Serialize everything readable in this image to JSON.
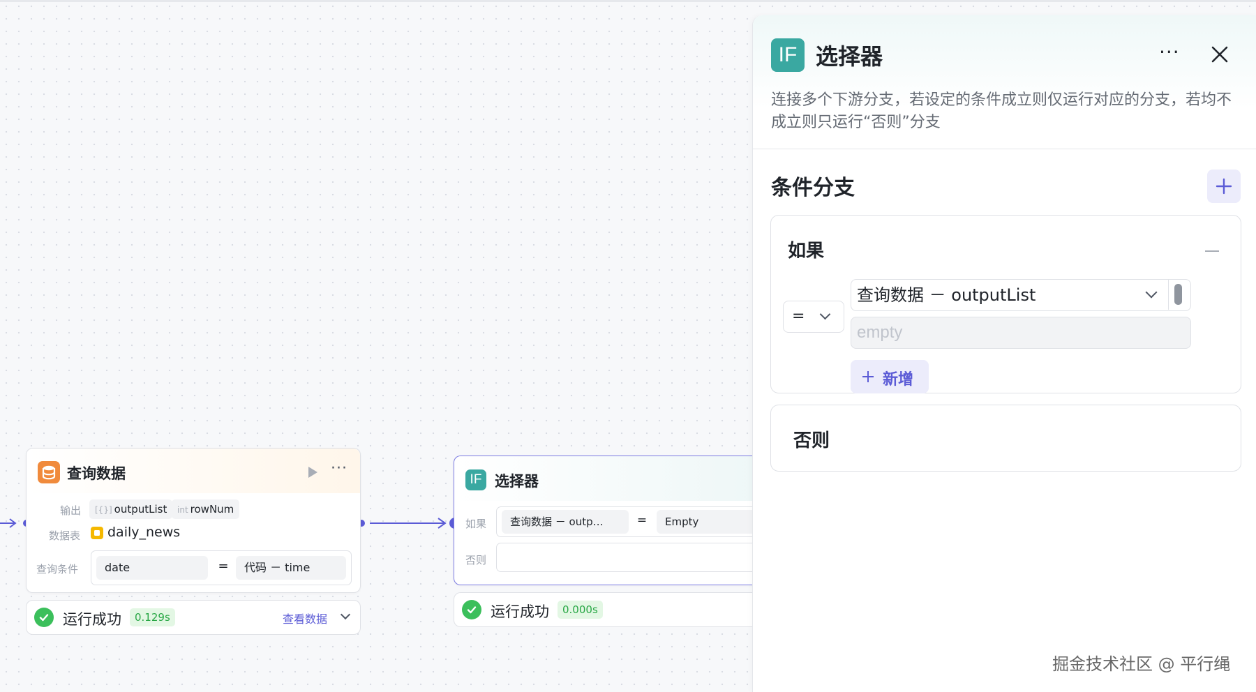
{
  "query_node": {
    "title": "查询数据",
    "output_label": "输出",
    "outputs": [
      {
        "type": "[{}]",
        "name": "outputList"
      },
      {
        "type": "int",
        "name": "rowNum"
      }
    ],
    "table_label": "数据表",
    "table_name": "daily_news",
    "condition_label": "查询条件",
    "condition_field": "date",
    "condition_op": "=",
    "condition_value": "代码 － time",
    "status_text": "运行成功",
    "status_time": "0.129s",
    "view_data_label": "查看数据"
  },
  "selector_node": {
    "title": "选择器",
    "if_label": "如果",
    "if_left": "查询数据 － outp…",
    "if_op": "=",
    "if_right": "Empty",
    "else_label": "否则",
    "status_text": "运行成功",
    "status_time": "0.000s"
  },
  "panel": {
    "icon_text": "IF",
    "title": "选择器",
    "description": "连接多个下游分支，若设定的条件成立则仅运行对应的分支，若均不成立则只运行“否则”分支",
    "section_title": "条件分支",
    "if_label": "如果",
    "operator": "=",
    "variable": "查询数据 － outputList",
    "value_placeholder": "empty",
    "add_label": "新增",
    "else_label": "否则"
  },
  "watermark": "掘金技术社区 @ 平行绳",
  "colors": {
    "accent": "#5b5bd6",
    "success": "#3bbf5b",
    "teal_icon": "#3aa8a1",
    "orange_icon": "#f08a3c"
  }
}
